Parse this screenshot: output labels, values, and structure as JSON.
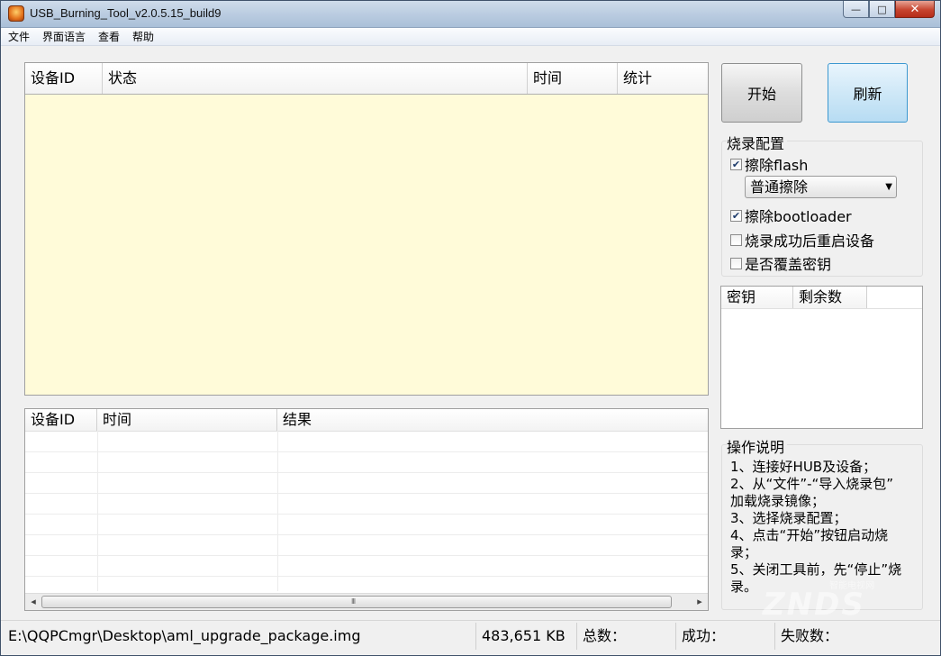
{
  "window": {
    "title": "USB_Burning_Tool_v2.0.5.15_build9",
    "controls": {
      "minimize": "—",
      "maximize": "□",
      "close": "✕"
    }
  },
  "menu": [
    "文件",
    "界面语言",
    "查看",
    "帮助"
  ],
  "device_table": {
    "columns": [
      "设备ID",
      "状态",
      "时间",
      "统计"
    ],
    "rows": []
  },
  "result_table": {
    "columns": [
      "设备ID",
      "时间",
      "结果"
    ],
    "rows": [],
    "scrollbar": {
      "left": "◂",
      "right": "▸",
      "grip": "III"
    }
  },
  "buttons": {
    "start": "开始",
    "refresh": "刷新"
  },
  "burn_config": {
    "title": "烧录配置",
    "erase_flash": {
      "label": "擦除flash",
      "checked": true
    },
    "erase_mode": {
      "value": "普通擦除"
    },
    "erase_bootloader": {
      "label": "擦除bootloader",
      "checked": true
    },
    "reboot_after": {
      "label": "烧录成功后重启设备",
      "checked": false
    },
    "overwrite_key": {
      "label": "是否覆盖密钥",
      "checked": false
    }
  },
  "key_table": {
    "columns": [
      "密钥",
      "剩余数"
    ],
    "rows": []
  },
  "instructions": {
    "title": "操作说明",
    "lines": [
      "1、连接好HUB及设备；",
      "2、从“文件”-“导入烧录包”",
      "加载烧录镜像；",
      "3、选择烧录配置；",
      "4、点击“开始”按钮启动烧",
      "录；",
      "5、关闭工具前，先“停止”烧",
      "录。"
    ]
  },
  "status_bar": {
    "path": "E:\\QQPCmgr\\Desktop\\aml_upgrade_package.img",
    "size": "483,651 KB",
    "total": "总数：",
    "success": "成功：",
    "fail": "失败数："
  },
  "watermark": {
    "big": "ZNDS",
    "small": "智能电视网"
  },
  "colors": {
    "device_table_bg": "#fffbd9",
    "refresh_button_bg": "#cfe8f7",
    "refresh_button_border": "#3c98d0"
  }
}
